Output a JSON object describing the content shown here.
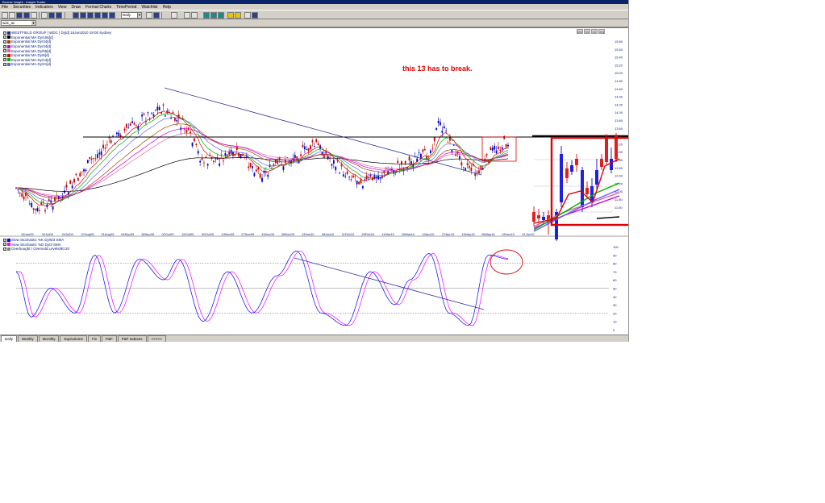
{
  "window": {
    "title": "Bourse Insight - Insight Trader"
  },
  "menu": [
    "File",
    "Securities",
    "Indicators",
    "View",
    "Draw",
    "Format Charts",
    "TimePeriod",
    "Watchlist",
    "Help"
  ],
  "toolbar": {
    "period_value": "Daily"
  },
  "security_input": {
    "value": "wdc_ax"
  },
  "navigation": {
    "first": "|<<",
    "prev": "<<",
    "next": ">>",
    "last": ">>|"
  },
  "price_panel": {
    "legend": [
      {
        "label": "WESTFIELD GROUP | WDC | Dy[d]  16Jun2010 19:00 Sydney",
        "color": "#1a2a8a"
      },
      {
        "label": "Exponential MA Dy/156[d]",
        "color": "#000000"
      },
      {
        "label": "Exponential MA Dy/34[d]",
        "color": "#a04000"
      },
      {
        "label": "Exponential MA Dy/44[d]",
        "color": "#d000d0"
      },
      {
        "label": "Exponential MA Dy/55[d]",
        "color": "#e060a0"
      },
      {
        "label": "Exponential MA Dy/8[d]",
        "color": "#e00000"
      },
      {
        "label": "Exponential MA Dy/13[d]",
        "color": "#00b000"
      },
      {
        "label": "Exponential MA Dy/21[d]",
        "color": "#6060ff"
      }
    ],
    "y_axis_labels": [
      "15.80",
      "15.60",
      "15.40",
      "15.20",
      "15.00",
      "14.80",
      "14.60",
      "14.40",
      "14.20",
      "14.00",
      "13.80",
      "13.60",
      "13.40",
      "13.20",
      "13.00",
      "12.80",
      "12.60",
      "12.40",
      "12.20",
      "12.00",
      "11.80",
      "11.60",
      "11.40",
      "11.20",
      "11.00",
      "10.80",
      "10.60",
      "10.40",
      "10.20",
      "10.00",
      "9.80",
      "9.60"
    ],
    "x_axis_labels": [
      "26Jun09",
      "10Jul09",
      "24Jul09",
      "07Aug09",
      "21Aug09",
      "04Sep09",
      "18Sep09",
      "02Oct09",
      "16Oct09",
      "30Oct09",
      "13Nov09",
      "27Nov09",
      "11Dec09",
      "28Dec09",
      "13Jan10",
      "28Jan10",
      "11Feb10",
      "25Feb10",
      "11Mar10",
      "25Mar10",
      "12Apr10",
      "27Apr10",
      "11May10",
      "25May10",
      "09Jun10",
      "21Jun10"
    ],
    "annotation": "this 13 has to break.",
    "annotation_color": "#e00000"
  },
  "stochastic_panel": {
    "legend": [
      {
        "label": "Slow Stochastic %K Dy/5/3 SMA",
        "color": "#0000ff"
      },
      {
        "label": "Slow Stochastic %D Dy/3 SMA",
        "color": "#ff00ff"
      },
      {
        "label": "Overbought / Oversold Levels/80:20",
        "color": "#808080"
      }
    ],
    "y_axis_labels": [
      "100",
      "90",
      "80",
      "70",
      "60",
      "50",
      "40",
      "30",
      "20",
      "10",
      "0"
    ],
    "overbought": 80,
    "oversold": 20,
    "midline": 50
  },
  "tabs": [
    "Daily",
    "Weekly",
    "Monthly",
    "Equivolume",
    "Fix",
    "P&F",
    "P&F Indexes",
    ">>>>>"
  ],
  "active_tab": 0
}
